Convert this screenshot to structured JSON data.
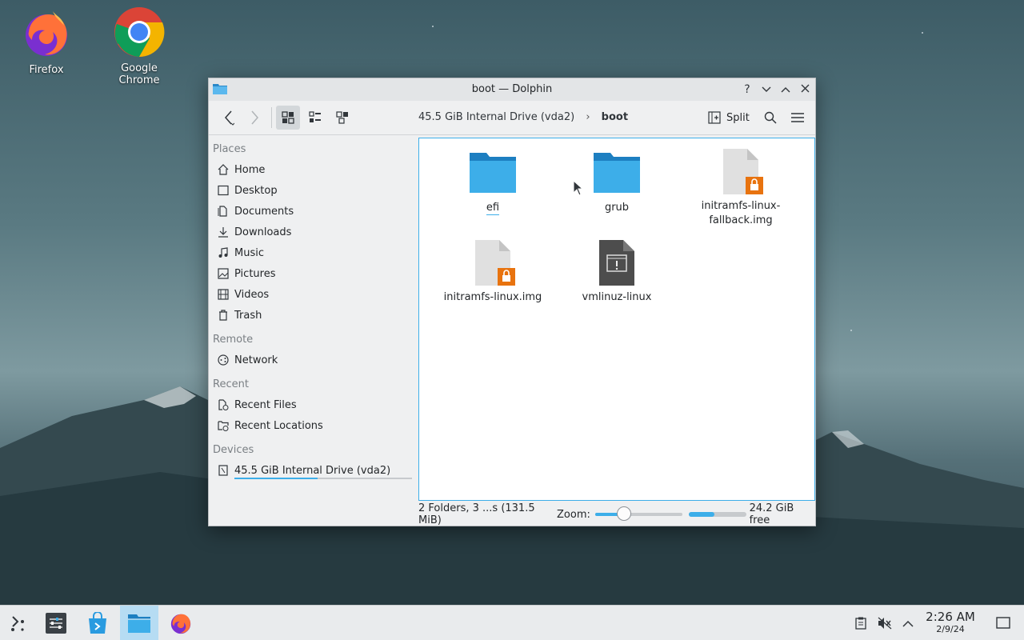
{
  "desktop": {
    "icons": [
      {
        "label": "Firefox",
        "icon": "firefox-icon"
      },
      {
        "label": "Google Chrome",
        "icon": "chrome-icon"
      }
    ]
  },
  "window": {
    "title": "boot — Dolphin",
    "controls": {
      "help": "?",
      "minimize": "⌄",
      "maximize": "⌃",
      "close": "✕"
    }
  },
  "toolbar": {
    "breadcrumb": {
      "drive": "45.5 GiB Internal Drive (vda2)",
      "current": "boot"
    },
    "split_label": "Split"
  },
  "sidebar": {
    "places_header": "Places",
    "places": [
      {
        "label": "Home",
        "icon": "home-icon"
      },
      {
        "label": "Desktop",
        "icon": "desktop-icon"
      },
      {
        "label": "Documents",
        "icon": "documents-icon"
      },
      {
        "label": "Downloads",
        "icon": "downloads-icon"
      },
      {
        "label": "Music",
        "icon": "music-icon"
      },
      {
        "label": "Pictures",
        "icon": "pictures-icon"
      },
      {
        "label": "Videos",
        "icon": "videos-icon"
      },
      {
        "label": "Trash",
        "icon": "trash-icon"
      }
    ],
    "remote_header": "Remote",
    "remote": [
      {
        "label": "Network",
        "icon": "network-icon"
      }
    ],
    "recent_header": "Recent",
    "recent": [
      {
        "label": "Recent Files",
        "icon": "recent-files-icon"
      },
      {
        "label": "Recent Locations",
        "icon": "recent-locations-icon"
      }
    ],
    "devices_header": "Devices",
    "devices": [
      {
        "label": "45.5 GiB Internal Drive (vda2)",
        "icon": "drive-icon",
        "usage": 0.47
      }
    ]
  },
  "files": [
    {
      "name": "efi",
      "type": "folder"
    },
    {
      "name": "grub",
      "type": "folder"
    },
    {
      "name": "initramfs-linux-fallback.img",
      "name_line1": "initramfs-linux-",
      "name_line2": "fallback.img",
      "type": "locked-file"
    },
    {
      "name": "initramfs-linux.img",
      "type": "locked-file"
    },
    {
      "name": "vmlinuz-linux",
      "type": "executable"
    }
  ],
  "status": {
    "summary": "2 Folders, 3 ...s (131.5 MiB)",
    "zoom_label": "Zoom:",
    "zoom_level": 0.28,
    "free_space": "24.2 GiB free",
    "used_fraction": 0.45
  },
  "taskbar": {
    "items": [
      "app-launcher-icon",
      "system-settings-icon",
      "discover-icon",
      "dolphin-icon",
      "firefox-icon"
    ],
    "clock": {
      "time": "2:26 AM",
      "date": "2/9/24"
    }
  }
}
